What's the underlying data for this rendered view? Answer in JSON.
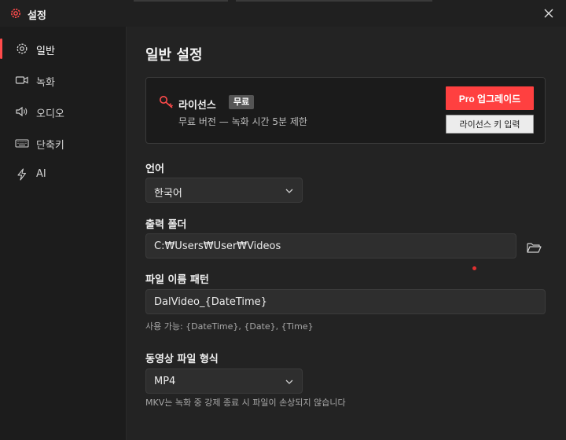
{
  "window": {
    "title": "설정",
    "accent": "#ff4b4b"
  },
  "sidebar": {
    "items": [
      {
        "label": "일반",
        "icon": "gear-icon",
        "active": true
      },
      {
        "label": "녹화",
        "icon": "video-camera-icon",
        "active": false
      },
      {
        "label": "오디오",
        "icon": "speaker-icon",
        "active": false
      },
      {
        "label": "단축키",
        "icon": "keyboard-icon",
        "active": false
      },
      {
        "label": "AI",
        "icon": "lightning-icon",
        "active": false
      }
    ]
  },
  "main": {
    "title": "일반 설정",
    "license": {
      "title": "라이선스",
      "badge": "무료",
      "description": "무료 버전 — 녹화 시간 5분 제한",
      "upgrade_button": "Pro 업그레이드",
      "enter_key_button": "라이선스 키 입력"
    },
    "language": {
      "label": "언어",
      "value": "한국어"
    },
    "output_folder": {
      "label": "출력 폴더",
      "value": "C:₩Users₩User₩Videos"
    },
    "filename_pattern": {
      "label": "파일 이름 패턴",
      "value": "DalVideo_{DateTime}",
      "hint": "사용 가능: {DateTime}, {Date}, {Time}"
    },
    "video_format": {
      "label": "동영상 파일 형식",
      "value": "MP4",
      "hint": "MKV는 녹화 중 강제 종료 시 파일이 손상되지 않습니다"
    }
  }
}
